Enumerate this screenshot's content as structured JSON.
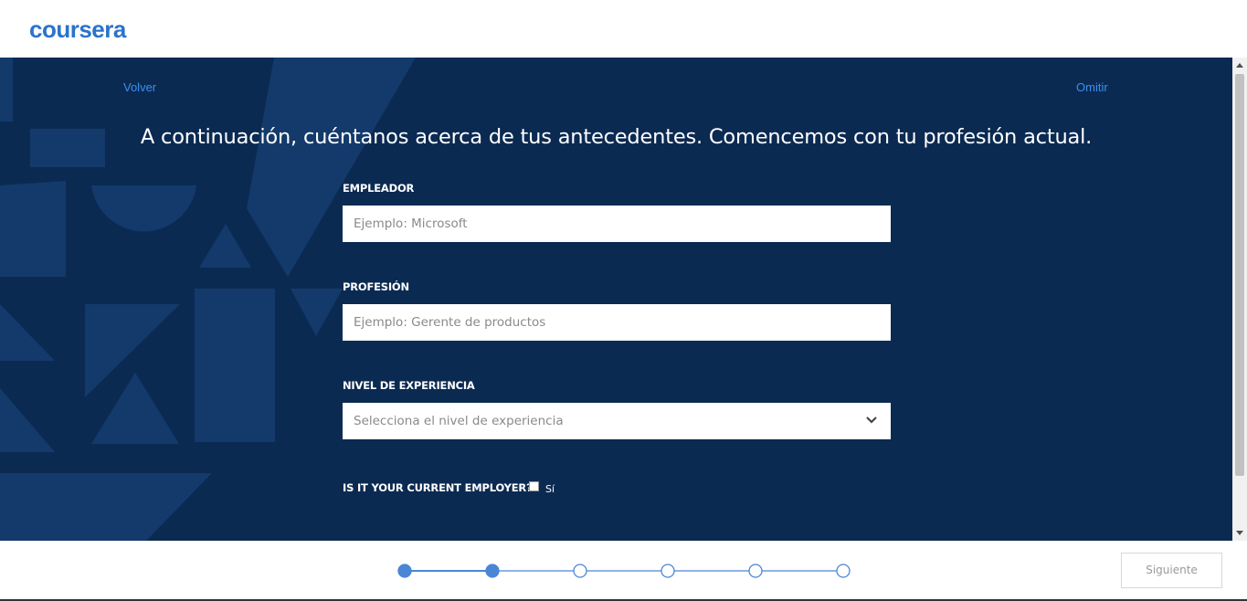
{
  "header": {
    "logo_text": "coursera"
  },
  "nav": {
    "back_label": "Volver",
    "skip_label": "Omitir"
  },
  "form": {
    "heading": "A continuación, cuéntanos acerca de tus antecedentes. Comencemos con tu profesión actual.",
    "employer": {
      "label": "EMPLEADOR",
      "placeholder": "Ejemplo: Microsoft",
      "value": ""
    },
    "profession": {
      "label": "PROFESIÓN",
      "placeholder": "Ejemplo: Gerente de productos",
      "value": ""
    },
    "experience": {
      "label": "NIVEL DE EXPERIENCIA",
      "selected": "Selecciona el nivel de experiencia"
    },
    "current_employer": {
      "label": "IS IT YOUR CURRENT EMPLOYER?",
      "option_label": "Sí",
      "checked": false
    }
  },
  "footer": {
    "next_label": "Siguiente",
    "progress": {
      "total_steps": 6,
      "completed_steps": 2
    }
  },
  "colors": {
    "panel_background": "#0b2a52",
    "brand_blue": "#2a73cc",
    "link_blue": "#3d8fef",
    "step_active": "#4a86d6"
  },
  "icons": {
    "select": "chevron-down-icon",
    "scroll_up": "arrow-up-icon",
    "scroll_down": "arrow-down-icon"
  }
}
